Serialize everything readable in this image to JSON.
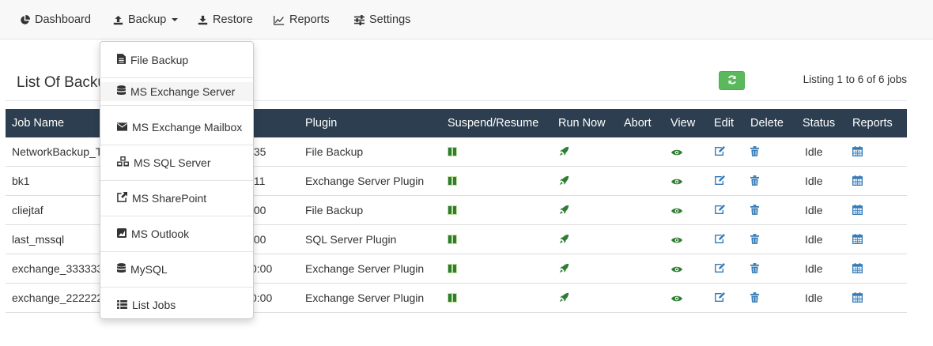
{
  "nav": {
    "dashboard": "Dashboard",
    "backup": "Backup",
    "restore": "Restore",
    "reports": "Reports",
    "settings": "Settings"
  },
  "page": {
    "heading": "List Of Backup Jobs",
    "listing": "Listing 1 to 6 of 6 jobs"
  },
  "backup_menu": [
    {
      "label": "File Backup",
      "icon": "file-icon"
    },
    {
      "label": "MS Exchange Server",
      "icon": "database-icon"
    },
    {
      "label": "MS Exchange Mailbox",
      "icon": "envelope-icon"
    },
    {
      "label": "MS SQL Server",
      "icon": "cubes-icon"
    },
    {
      "label": "MS SharePoint",
      "icon": "external-link-icon"
    },
    {
      "label": "MS Outlook",
      "icon": "outlook-icon"
    },
    {
      "label": "MySQL",
      "icon": "database-icon"
    },
    {
      "label": "List Jobs",
      "icon": "list-icon"
    }
  ],
  "table": {
    "headers": {
      "job_name": "Job Name",
      "plugin": "Plugin",
      "suspend": "Suspend/Resume",
      "run_now": "Run Now",
      "abort": "Abort",
      "view": "View",
      "edit": "Edit",
      "delete": "Delete",
      "status": "Status",
      "reports": "Reports"
    },
    "rows": [
      {
        "name": "NetworkBackup_T",
        "time": ":35",
        "plugin": "File Backup",
        "status": "Idle"
      },
      {
        "name": "bk1",
        "time": ":11",
        "plugin": "Exchange Server Plugin",
        "status": "Idle"
      },
      {
        "name": "cliejtaf",
        "time": ":00",
        "plugin": "File Backup",
        "status": "Idle"
      },
      {
        "name": "last_mssql",
        "time": ":00",
        "plugin": "SQL Server Plugin",
        "status": "Idle"
      },
      {
        "name": "exchange_333333",
        "time": "0:00",
        "plugin": "Exchange Server Plugin",
        "status": "Idle"
      },
      {
        "name": "exchange_222222",
        "time": "0:00",
        "plugin": "Exchange Server Plugin",
        "status": "Idle"
      }
    ]
  },
  "colors": {
    "header_bg": "#2c3e50",
    "success": "#5cb85c",
    "action_green": "#2e7d32",
    "action_blue": "#337ab7"
  }
}
